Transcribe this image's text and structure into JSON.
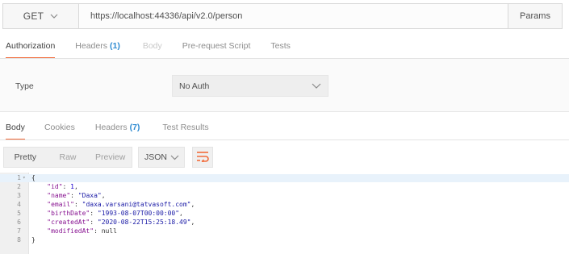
{
  "request": {
    "method": "GET",
    "url": "https://localhost:44336/api/v2.0/person",
    "params_label": "Params"
  },
  "request_tabs": [
    {
      "label": "Authorization",
      "count": "",
      "state": "active"
    },
    {
      "label": "Headers",
      "count": "(1)",
      "state": "normal"
    },
    {
      "label": "Body",
      "count": "",
      "state": "disabled"
    },
    {
      "label": "Pre-request Script",
      "count": "",
      "state": "normal"
    },
    {
      "label": "Tests",
      "count": "",
      "state": "normal"
    }
  ],
  "auth": {
    "type_label": "Type",
    "type_value": "No Auth"
  },
  "response_tabs": [
    {
      "label": "Body",
      "count": "",
      "state": "active"
    },
    {
      "label": "Cookies",
      "count": "",
      "state": "normal"
    },
    {
      "label": "Headers",
      "count": "(7)",
      "state": "normal"
    },
    {
      "label": "Test Results",
      "count": "",
      "state": "normal"
    }
  ],
  "response_view": {
    "modes": [
      "Pretty",
      "Raw",
      "Preview"
    ],
    "active_mode": "Pretty",
    "format": "JSON"
  },
  "body_lines": [
    {
      "num": "1",
      "fold": "▾",
      "text": "{"
    },
    {
      "num": "2",
      "key": "\"id\"",
      "val": "1",
      "val_type": "n",
      "comma": ","
    },
    {
      "num": "3",
      "key": "\"name\"",
      "val": "\"Daxa\"",
      "val_type": "s",
      "comma": ","
    },
    {
      "num": "4",
      "key": "\"email\"",
      "val": "\"daxa.varsani@tatvasoft.com\"",
      "val_type": "s",
      "comma": ","
    },
    {
      "num": "5",
      "key": "\"birthDate\"",
      "val": "\"1993-08-07T00:00:00\"",
      "val_type": "s",
      "comma": ","
    },
    {
      "num": "6",
      "key": "\"createdAt\"",
      "val": "\"2020-08-22T15:25:18.49\"",
      "val_type": "s",
      "comma": ","
    },
    {
      "num": "7",
      "key": "\"modifiedAt\"",
      "val": "null",
      "val_type": "p",
      "comma": ""
    },
    {
      "num": "8",
      "fold": "",
      "text": "}"
    }
  ],
  "colors": {
    "accent": "#f26b3a",
    "count_blue": "#2d8ad1",
    "json_key": "#881391",
    "json_string": "#1a1aa6"
  },
  "icons": {
    "method_dropdown": "chevron-down-icon",
    "auth_dropdown": "chevron-down-icon",
    "format_dropdown": "chevron-down-icon",
    "wrap": "wrap-lines-icon"
  }
}
